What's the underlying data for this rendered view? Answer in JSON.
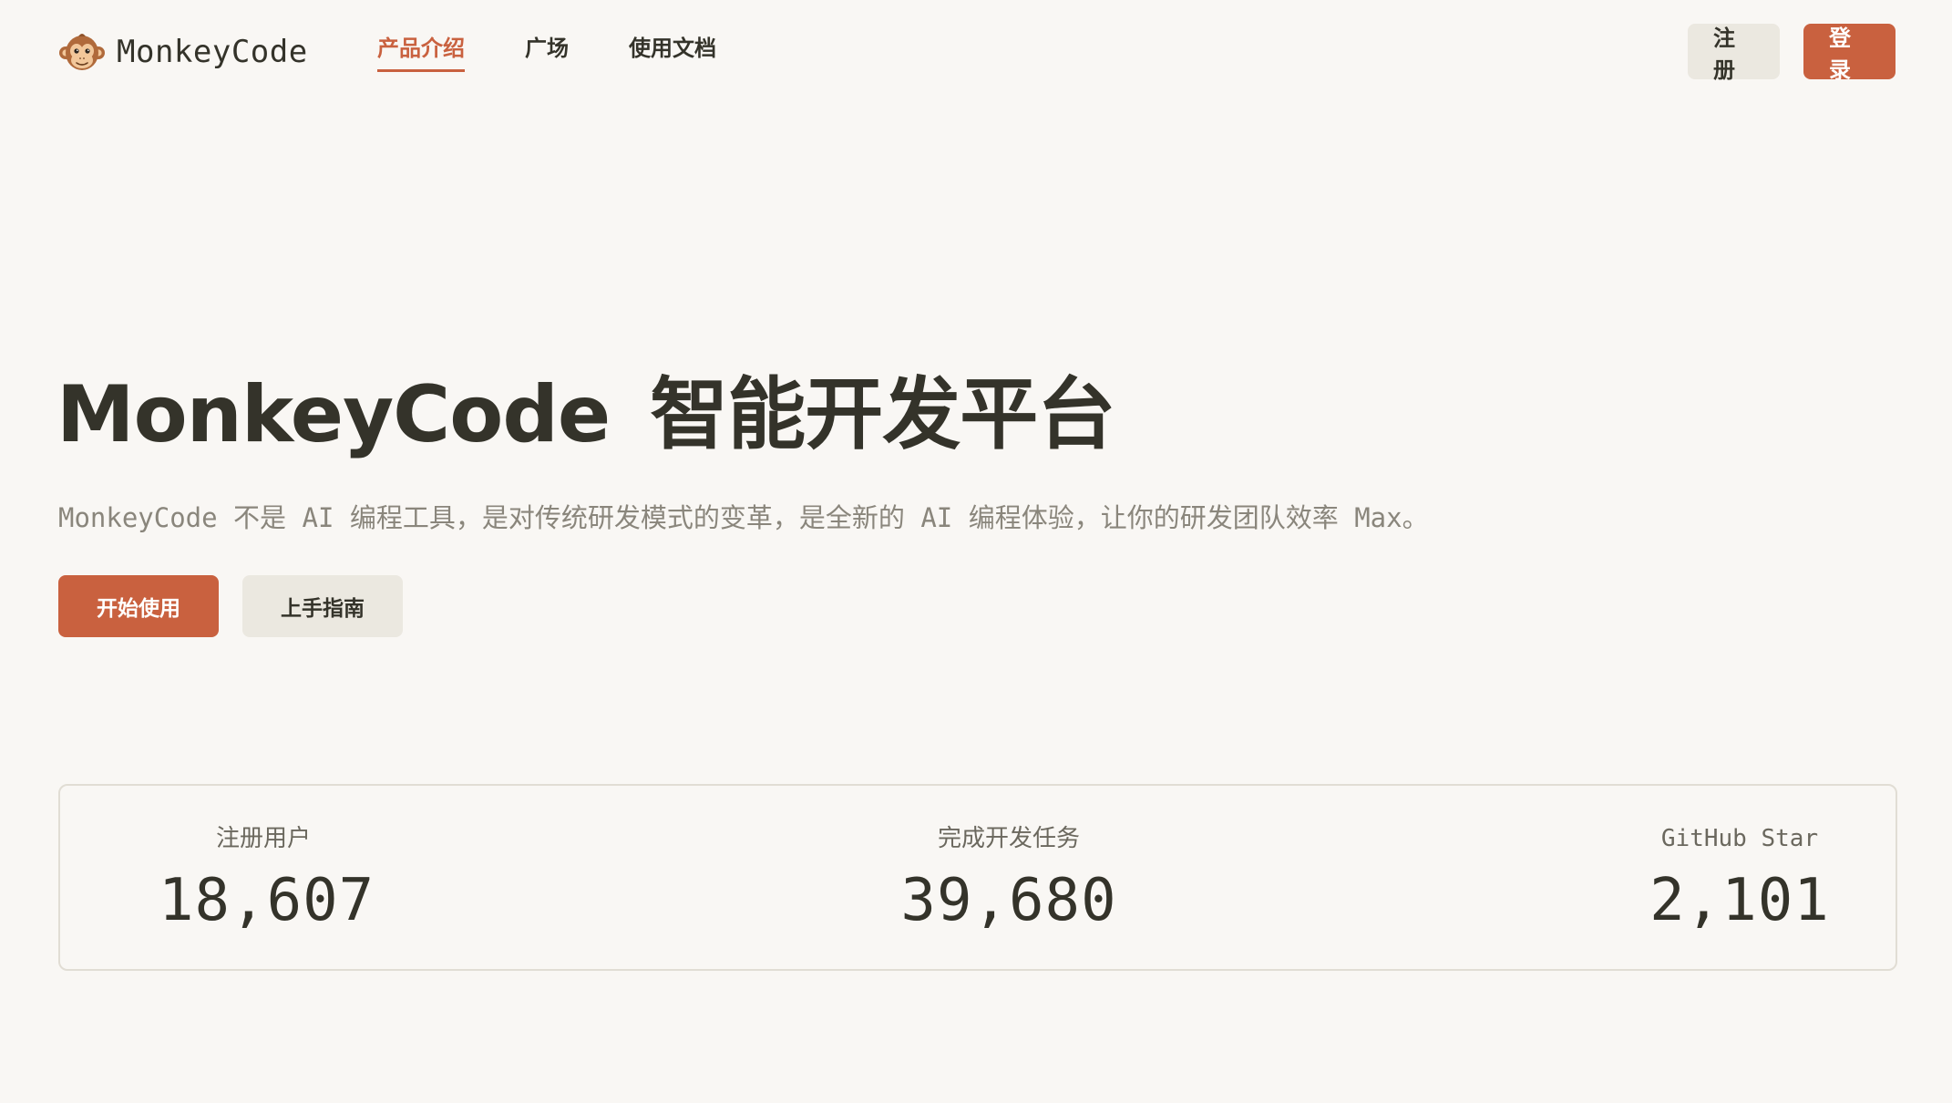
{
  "app": {
    "name": "MonkeyCode",
    "logo_icon": "monkey-face-icon"
  },
  "nav": {
    "items": [
      {
        "label": "产品介绍",
        "active": true
      },
      {
        "label": "广场",
        "active": false
      },
      {
        "label": "使用文档",
        "active": false
      }
    ]
  },
  "header_actions": {
    "register_label": "注册",
    "login_label": "登录"
  },
  "hero": {
    "title_brand": "MonkeyCode",
    "title_rest": "智能开发平台",
    "description": "MonkeyCode 不是 AI 编程工具，是对传统研发模式的变革，是全新的 AI 编程体验，让你的研发团队效率 Max。",
    "primary_button": "开始使用",
    "secondary_button": "上手指南"
  },
  "stats": [
    {
      "label": "注册用户",
      "value": "18,607"
    },
    {
      "label": "完成开发任务",
      "value": "39,680"
    },
    {
      "label": "GitHub Star",
      "value": "2,101"
    }
  ],
  "colors": {
    "background": "#f9f7f4",
    "accent": "#c9613f",
    "text": "#34332a",
    "muted_text": "#8a867c",
    "secondary_button": "#ebe8e0",
    "border": "#e1ddd4"
  }
}
